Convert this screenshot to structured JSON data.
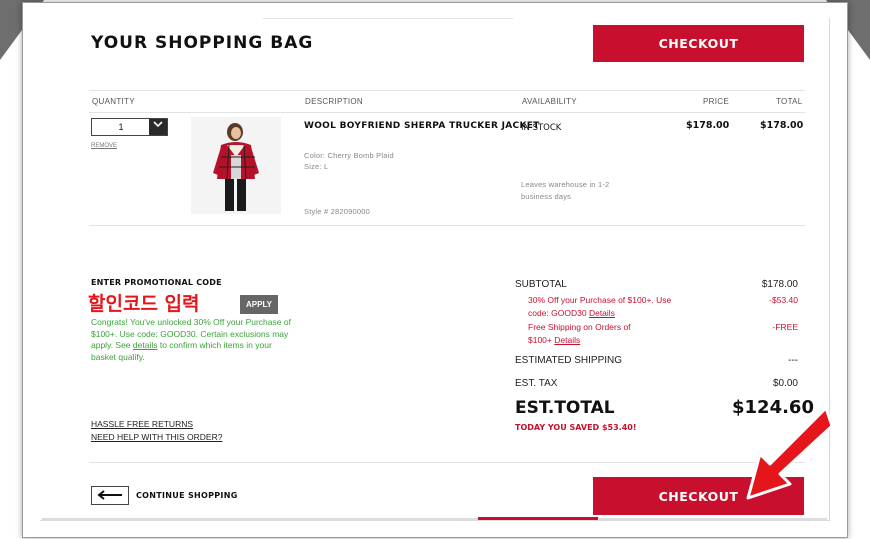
{
  "header": {
    "title": "YOUR SHOPPING BAG",
    "checkout_label": "CHECKOUT"
  },
  "columns": {
    "quantity": "QUANTITY",
    "description": "DESCRIPTION",
    "availability": "AVAILABILITY",
    "price": "PRICE",
    "total": "TOTAL"
  },
  "item": {
    "quantity": "1",
    "remove_label": "REMOVE",
    "name": "WOOL BOYFRIEND SHERPA TRUCKER JACKET",
    "color": "Color:  Cherry Bomb Plaid",
    "size": "Size:  L",
    "style": "Style #  282090000",
    "availability": "IN STOCK",
    "shipping_note_1": "Leaves warehouse in 1-2",
    "shipping_note_2": "business days",
    "price": "$178.00",
    "total": "$178.00"
  },
  "promo": {
    "label": "ENTER PROMOTIONAL CODE",
    "overlay_text": "할인코드 입력",
    "apply_label": "APPLY",
    "message_1": "Congrats! You've unlocked 30% Off your Purchase of $100+. Use code: GOOD30. Certain exclusions may apply. See ",
    "message_link": "details",
    "message_2": " to confirm which items in your basket qualify."
  },
  "help_links": {
    "returns": "HASSLE FREE RETURNS",
    "help": "NEED HELP WITH THIS ORDER?"
  },
  "summary": {
    "subtotal_label": "SUBTOTAL",
    "subtotal_value": "$178.00",
    "discount_text_1": "30% Off your Purchase of $100+. Use",
    "discount_text_2": "code: GOOD30 ",
    "discount_link": "Details",
    "discount_value": "-$53.40",
    "shipping_promo_1": "Free Shipping on Orders of",
    "shipping_promo_2": "$100+ ",
    "shipping_promo_link": "Details",
    "shipping_promo_value": "-FREE",
    "est_shipping_label": "ESTIMATED SHIPPING",
    "est_shipping_value": "---",
    "tax_label": "EST. TAX",
    "tax_value": "$0.00",
    "total_label": "EST.TOTAL",
    "total_value": "$124.60",
    "saved_text": "TODAY YOU SAVED  $53.40!"
  },
  "footer": {
    "continue_label": "CONTINUE SHOPPING",
    "checkout_label": "CHECKOUT"
  },
  "colors": {
    "accent": "#c8102e",
    "promo_green": "#3aa43a",
    "overlay_red": "#e4161c"
  },
  "icons": {
    "dropdown": "chevron-down-icon",
    "back": "arrow-left-icon",
    "annotation": "red-arrow-icon"
  }
}
